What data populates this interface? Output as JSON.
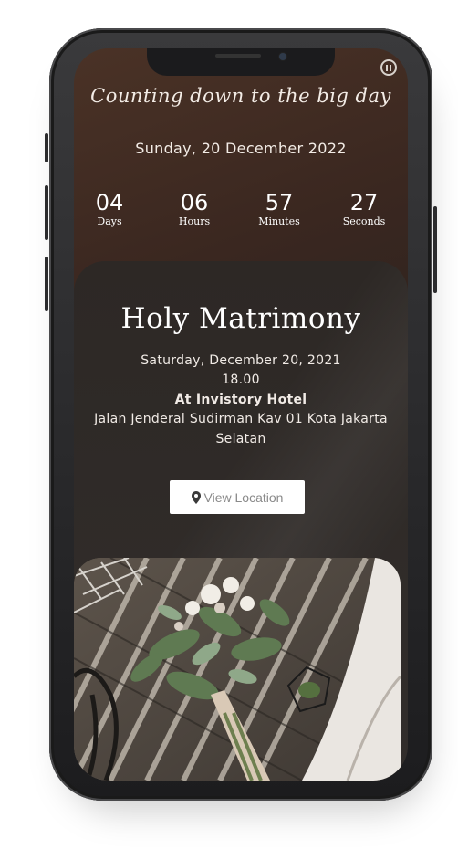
{
  "countdown": {
    "script_title": "Counting down to the big day",
    "date": "Sunday, 20 December 2022",
    "units": [
      {
        "value": "04",
        "label": "Days"
      },
      {
        "value": "06",
        "label": "Hours"
      },
      {
        "value": "57",
        "label": "Minutes"
      },
      {
        "value": "27",
        "label": "Seconds"
      }
    ]
  },
  "event": {
    "title": "Holy Matrimony",
    "date": "Saturday, December 20, 2021",
    "time": "18.00",
    "venue": "At Invistory Hotel",
    "address_line1": "Jalan Jenderal Sudirman Kav 01 Kota Jakarta",
    "address_line2": "Selatan",
    "location_button": "View Location"
  },
  "icons": {
    "pause": "pause-icon",
    "location": "map-pin-icon"
  },
  "colors": {
    "screen_bg": "#3a2720",
    "card_bg": "#2d2825",
    "text": "#f3ece6",
    "button_bg": "#ffffff"
  }
}
